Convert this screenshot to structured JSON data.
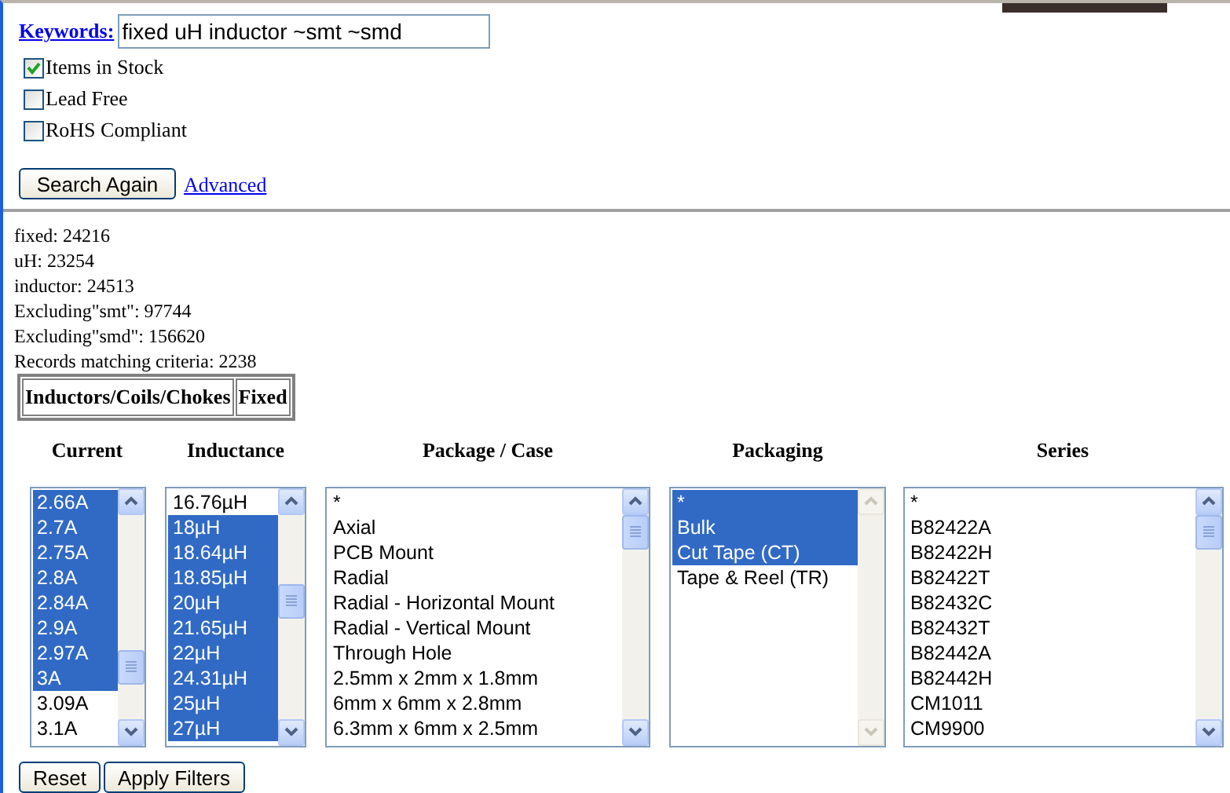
{
  "search": {
    "label": "Keywords:",
    "value": "fixed uH inductor ~smt ~smd"
  },
  "checkboxes": [
    {
      "label": "Items in Stock",
      "checked": true
    },
    {
      "label": "Lead Free",
      "checked": false
    },
    {
      "label": "RoHS Compliant",
      "checked": false
    }
  ],
  "search_button": "Search Again",
  "advanced_link": "Advanced",
  "stats": [
    "fixed: 24216",
    "uH: 23254",
    "inductor: 24513",
    "Excluding\"smt\": 97744",
    "Excluding\"smd\": 156620",
    "Records matching criteria: 2238"
  ],
  "category_path": [
    "Inductors/Coils/Chokes",
    "Fixed"
  ],
  "filters": [
    {
      "title": "Current",
      "scrollable": true,
      "items": [
        {
          "label": "2.66A",
          "selected": true
        },
        {
          "label": "2.7A",
          "selected": true
        },
        {
          "label": "2.75A",
          "selected": true
        },
        {
          "label": "2.8A",
          "selected": true
        },
        {
          "label": "2.84A",
          "selected": true
        },
        {
          "label": "2.9A",
          "selected": true
        },
        {
          "label": "2.97A",
          "selected": true
        },
        {
          "label": "3A",
          "selected": true
        },
        {
          "label": "3.09A",
          "selected": false
        },
        {
          "label": "3.1A",
          "selected": false
        }
      ]
    },
    {
      "title": "Inductance",
      "scrollable": true,
      "items": [
        {
          "label": "16.76µH",
          "selected": false
        },
        {
          "label": "18µH",
          "selected": true
        },
        {
          "label": "18.64µH",
          "selected": true
        },
        {
          "label": "18.85µH",
          "selected": true
        },
        {
          "label": "20µH",
          "selected": true
        },
        {
          "label": "21.65µH",
          "selected": true
        },
        {
          "label": "22µH",
          "selected": true
        },
        {
          "label": "24.31µH",
          "selected": true
        },
        {
          "label": "25µH",
          "selected": true
        },
        {
          "label": "27µH",
          "selected": true
        }
      ]
    },
    {
      "title": "Package / Case",
      "scrollable": true,
      "items": [
        {
          "label": "*",
          "selected": false
        },
        {
          "label": "Axial",
          "selected": false
        },
        {
          "label": "PCB Mount",
          "selected": false
        },
        {
          "label": "Radial",
          "selected": false
        },
        {
          "label": "Radial - Horizontal Mount",
          "selected": false
        },
        {
          "label": "Radial - Vertical Mount",
          "selected": false
        },
        {
          "label": "Through Hole",
          "selected": false
        },
        {
          "label": "2.5mm x 2mm x 1.8mm",
          "selected": false
        },
        {
          "label": "6mm x 6mm x 2.8mm",
          "selected": false
        },
        {
          "label": "6.3mm x 6mm x 2.5mm",
          "selected": false
        }
      ]
    },
    {
      "title": "Packaging",
      "scrollable": false,
      "items": [
        {
          "label": "*",
          "selected": true
        },
        {
          "label": "Bulk",
          "selected": true
        },
        {
          "label": "Cut Tape (CT)",
          "selected": true
        },
        {
          "label": "Tape & Reel (TR)",
          "selected": false
        }
      ]
    },
    {
      "title": "Series",
      "scrollable": true,
      "items": [
        {
          "label": "*",
          "selected": false
        },
        {
          "label": "B82422A",
          "selected": false
        },
        {
          "label": "B82422H",
          "selected": false
        },
        {
          "label": "B82422T",
          "selected": false
        },
        {
          "label": "B82432C",
          "selected": false
        },
        {
          "label": "B82432T",
          "selected": false
        },
        {
          "label": "B82442A",
          "selected": false
        },
        {
          "label": "B82442H",
          "selected": false
        },
        {
          "label": "CM1011",
          "selected": false
        },
        {
          "label": "CM9900",
          "selected": false
        }
      ]
    }
  ],
  "buttons": [
    "Reset",
    "Apply Filters"
  ]
}
